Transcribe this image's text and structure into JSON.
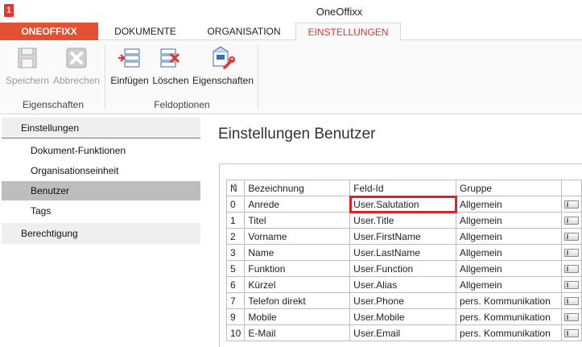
{
  "app": {
    "logo": "1",
    "title": "OneOffixx"
  },
  "tabs": [
    {
      "label": "ONEOFFIXX"
    },
    {
      "label": "DOKUMENTE"
    },
    {
      "label": "ORGANISATION"
    },
    {
      "label": "EINSTELLUNGEN"
    }
  ],
  "ribbon": {
    "save": {
      "label": "Speichern",
      "icon": "floppy-disk-icon"
    },
    "cancel": {
      "label": "Abbrechen",
      "icon": "x-icon"
    },
    "insert": {
      "label": "Einfügen",
      "icon": "insert-field-icon"
    },
    "delete": {
      "label": "Löschen",
      "icon": "delete-field-icon"
    },
    "properties": {
      "label": "Eigenschaften",
      "icon": "properties-wrench-icon"
    },
    "group1": "Eigenschaften",
    "group2": "Feldoptionen"
  },
  "sidebar": {
    "section_settings": "Einstellungen",
    "items": [
      "Dokument-Funktionen",
      "Organisationseinheit",
      "Benutzer",
      "Tags"
    ],
    "section_permissions": "Berechtigung"
  },
  "main": {
    "title": "Einstellungen Benutzer",
    "columns": {
      "n": "N",
      "bez": "Bezeichnung",
      "feld": "Feld-Id",
      "grp": "Gruppe"
    },
    "rows": [
      {
        "n": "0",
        "bez": "Anrede",
        "feld": "User.Salutation",
        "grp": "Allgemein"
      },
      {
        "n": "1",
        "bez": "Titel",
        "feld": "User.Title",
        "grp": "Allgemein"
      },
      {
        "n": "2",
        "bez": "Vorname",
        "feld": "User.FirstName",
        "grp": "Allgemein"
      },
      {
        "n": "3",
        "bez": "Name",
        "feld": "User.LastName",
        "grp": "Allgemein"
      },
      {
        "n": "5",
        "bez": "Funktion",
        "feld": "User.Function",
        "grp": "Allgemein"
      },
      {
        "n": "6",
        "bez": "Kürzel",
        "feld": "User.Alias",
        "grp": "Allgemein"
      },
      {
        "n": "7",
        "bez": "Telefon direkt",
        "feld": "User.Phone",
        "grp": "pers. Kommunikation"
      },
      {
        "n": "9",
        "bez": "Mobile",
        "feld": "User.Mobile",
        "grp": "pers. Kommunikation"
      },
      {
        "n": "10",
        "bez": "E-Mail",
        "feld": "User.Email",
        "grp": "pers. Kommunikation"
      }
    ]
  },
  "colors": {
    "brand": "#e35032",
    "highlight": "#e0202b",
    "selected_row": "#bdbdbd"
  }
}
